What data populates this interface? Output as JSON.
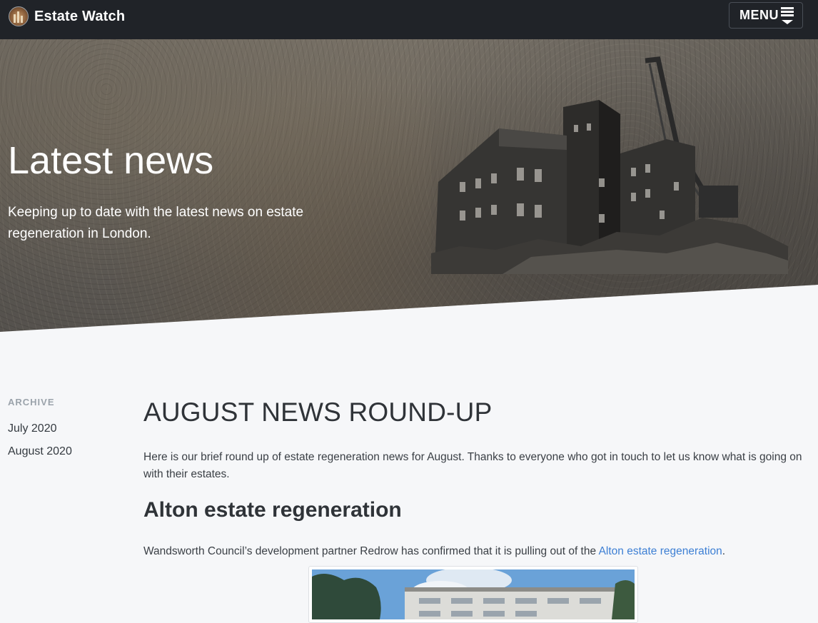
{
  "navbar": {
    "brand_name": "Estate Watch",
    "menu_label": "MENU"
  },
  "hero": {
    "title": "Latest news",
    "subtitle": "Keeping up to date with the latest news on estate regeneration in London."
  },
  "sidebar": {
    "heading": "ARCHIVE",
    "items": [
      {
        "label": "July 2020"
      },
      {
        "label": "August 2020"
      }
    ]
  },
  "article": {
    "title": "AUGUST NEWS ROUND-UP",
    "intro": "Here is our brief round up of estate regeneration news for August. Thanks to everyone who got in touch to let us know what is going on with their estates.",
    "section_title": "Alton estate regeneration",
    "para_text": "Wandsworth Council’s development partner Redrow has confirmed that it is pulling out of the ",
    "para_link": "Alton estate regeneration",
    "para_end": "."
  },
  "colors": {
    "navbar_bg": "#202328",
    "page_bg": "#f6f7f9",
    "link": "#3d7fd4",
    "sidebar_heading": "#9ba3ab"
  },
  "icons": [
    "estate-watch-logo-icon",
    "hamburger-menu-icon"
  ]
}
